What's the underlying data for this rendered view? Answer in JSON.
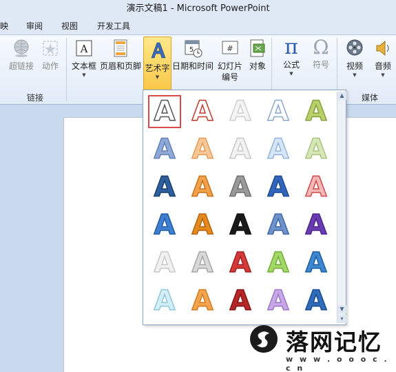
{
  "window": {
    "title": "演示文稿1 - Microsoft PowerPoint"
  },
  "menu": {
    "tabs": [
      "映",
      "审阅",
      "视图",
      "开发工具"
    ]
  },
  "ribbon": {
    "links_group": {
      "label": "链接",
      "hyperlink": "超链接",
      "action": "动作"
    },
    "text_group": {
      "textbox": "文本框",
      "header_footer": "页眉和页脚",
      "wordart": "艺术字",
      "datetime": "日期和时间",
      "slide_number_1": "幻灯片",
      "slide_number_2": "编号",
      "object": "对象"
    },
    "symbols_group": {
      "equation_glyph": "π",
      "equation": "公式",
      "symbol_glyph": "Ω",
      "symbol": "符号"
    },
    "media_group": {
      "label": "媒体",
      "video": "视频",
      "audio": "音频"
    }
  },
  "gallery": {
    "glyph": "A",
    "selected_index": 0,
    "styles": [
      {
        "fill": "#ffffff",
        "stroke": "#555555",
        "note": "outline"
      },
      {
        "fill": "#ffffff",
        "stroke": "#c0392b"
      },
      {
        "fill": "#f4f4f4",
        "stroke": "#cfcfcf"
      },
      {
        "fill": "#ffffff",
        "stroke": "#8aa7cf"
      },
      {
        "fill": "#b7d06a",
        "stroke": "#8aa040"
      },
      {
        "fill": "#8fa9d6",
        "stroke": "#6482b8"
      },
      {
        "fill": "#f7c89a",
        "stroke": "#e79a55"
      },
      {
        "fill": "#f2f2f2",
        "stroke": "#c8c8c8"
      },
      {
        "fill": "#d7e6f6",
        "stroke": "#8fb4de"
      },
      {
        "fill": "#d7e7b8",
        "stroke": "#a9c47c"
      },
      {
        "fill": "#2d5f9e",
        "stroke": "#1c3f6b"
      },
      {
        "fill": "#f2a04a",
        "stroke": "#c8711c"
      },
      {
        "fill": "#9a9a9a",
        "stroke": "#6e6e6e"
      },
      {
        "fill": "#3366bb",
        "stroke": "#1d4a94"
      },
      {
        "fill": "#f4b7b7",
        "stroke": "#d04a4a"
      },
      {
        "fill": "#3f7fcf",
        "stroke": "#1e5aa6"
      },
      {
        "fill": "#e4891d",
        "stroke": "#b4620c"
      },
      {
        "fill": "#1b1b1b",
        "stroke": "#111111"
      },
      {
        "fill": "#6f93c9",
        "stroke": "#3e67a7"
      },
      {
        "fill": "#6a3cb3",
        "stroke": "#4b2389"
      },
      {
        "fill": "#f1f1f1",
        "stroke": "#c8c8c8"
      },
      {
        "fill": "#d8d8d8",
        "stroke": "#a6a6a6"
      },
      {
        "fill": "#d53a3a",
        "stroke": "#a01f1f"
      },
      {
        "fill": "#a4d76a",
        "stroke": "#6fae2f"
      },
      {
        "fill": "#3d86d0",
        "stroke": "#1e5f9e"
      },
      {
        "fill": "#d5eef6",
        "stroke": "#8cc9de"
      },
      {
        "fill": "#f3a44f",
        "stroke": "#d27a1f"
      },
      {
        "fill": "#b52727",
        "stroke": "#821515"
      },
      {
        "fill": "#c7a7e6",
        "stroke": "#9b77c8"
      },
      {
        "fill": "#2f6dbb",
        "stroke": "#1b4c8b"
      }
    ]
  },
  "watermark": {
    "text": "落网记忆",
    "url": "w w w . o o o c . c n"
  }
}
